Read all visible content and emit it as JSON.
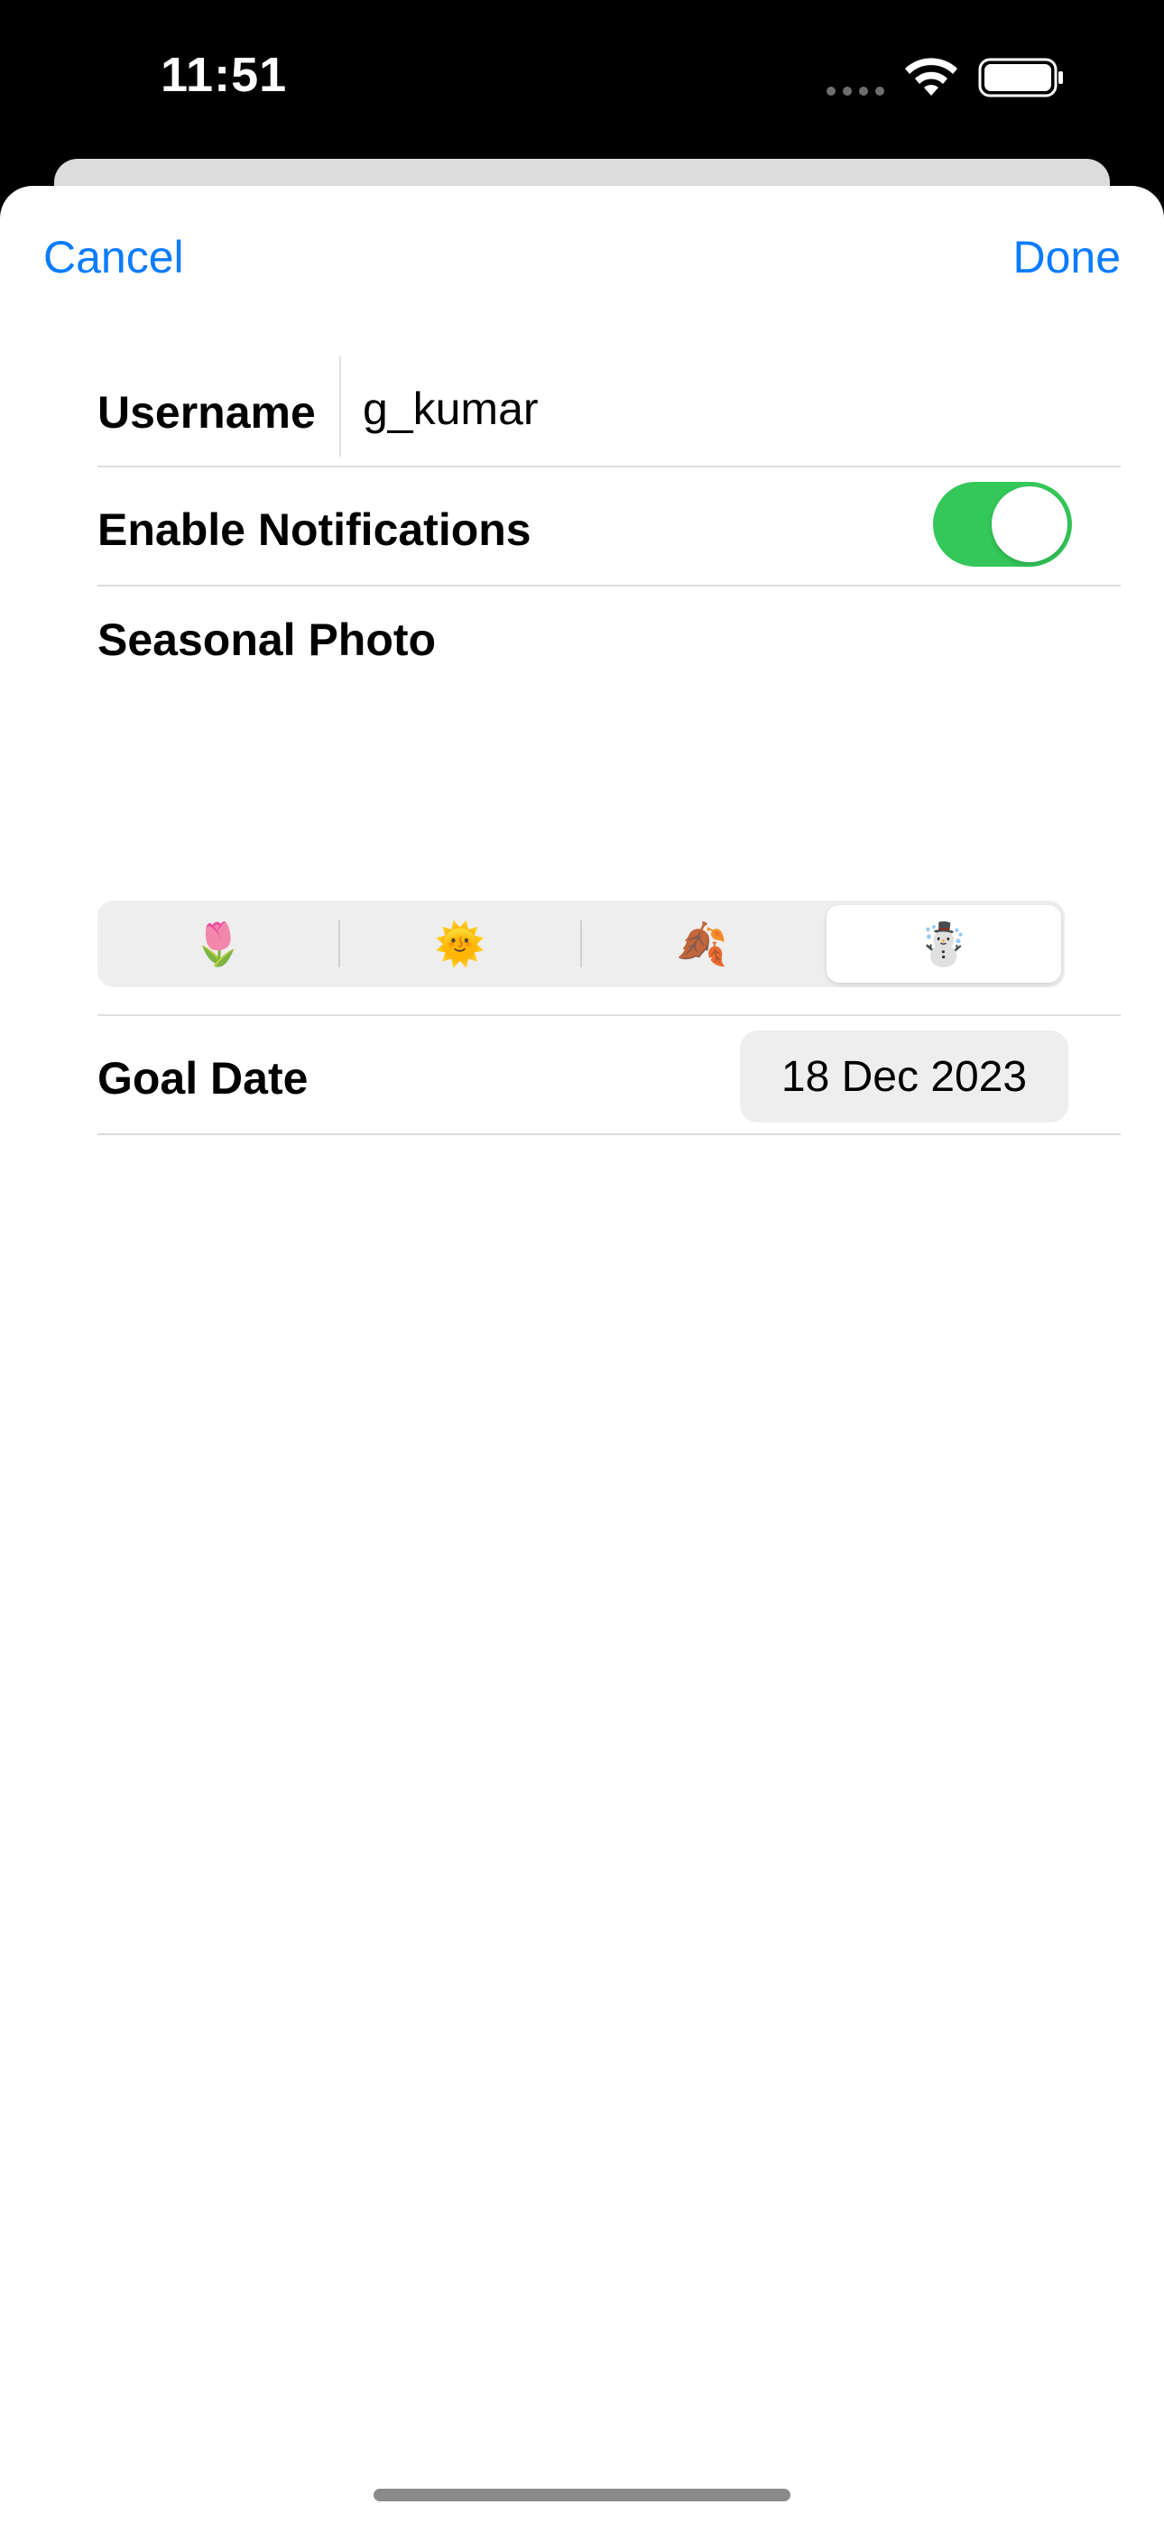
{
  "status_bar": {
    "time": "11:51"
  },
  "nav": {
    "cancel_label": "Cancel",
    "done_label": "Done"
  },
  "form": {
    "username": {
      "label": "Username",
      "value": "g_kumar"
    },
    "notifications": {
      "label": "Enable Notifications",
      "enabled": true
    },
    "seasonal_photo": {
      "label": "Seasonal Photo",
      "options": [
        "🌷",
        "🌞",
        "🍂",
        "☃️"
      ],
      "selected": "☃️"
    },
    "goal_date": {
      "label": "Goal Date",
      "value": "18 Dec 2023"
    }
  },
  "colors": {
    "accent": "#0a7cff",
    "toggle_on": "#34c759"
  },
  "icons": [
    "wifi-icon",
    "battery-icon"
  ]
}
